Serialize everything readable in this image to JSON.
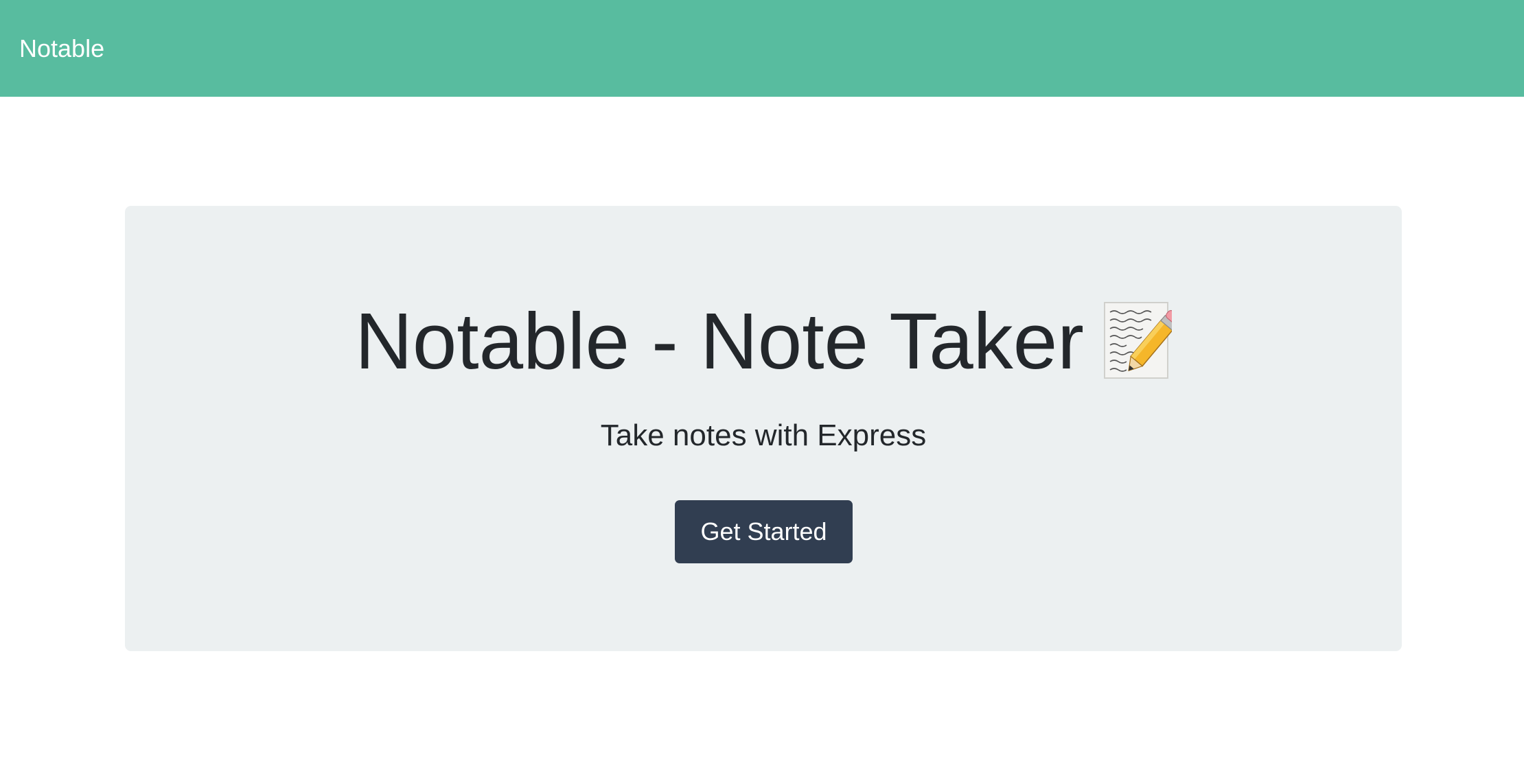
{
  "navbar": {
    "brand": "Notable",
    "background_color": "#58bc9f"
  },
  "hero": {
    "title": "Notable - Note Taker",
    "title_icon": "memo-icon",
    "subtitle": "Take notes with Express",
    "cta_label": "Get Started",
    "cta_color": "#313e51",
    "panel_color": "#ecf0f1"
  }
}
